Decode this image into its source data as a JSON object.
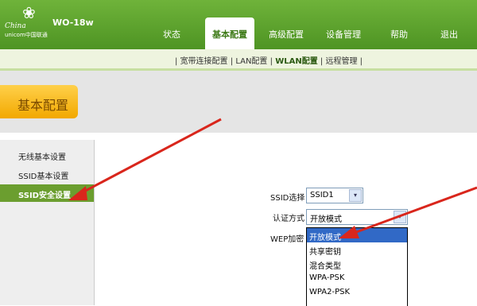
{
  "header": {
    "logo_line1": "China",
    "logo_line2": "unicom中国联通",
    "model": "WO-18w",
    "nav": [
      {
        "label": "状态",
        "active": false
      },
      {
        "label": "基本配置",
        "active": true
      },
      {
        "label": "高级配置",
        "active": false
      },
      {
        "label": "设备管理",
        "active": false
      },
      {
        "label": "帮助",
        "active": false
      },
      {
        "label": "退出",
        "active": false
      }
    ]
  },
  "subnav": {
    "sep": "|",
    "items": [
      {
        "label": "宽带连接配置",
        "active": false
      },
      {
        "label": "LAN配置",
        "active": false
      },
      {
        "label": "WLAN配置",
        "active": true
      },
      {
        "label": "远程管理",
        "active": false
      }
    ]
  },
  "section_title": "基本配置",
  "sidebar": {
    "items": [
      {
        "label": "无线基本设置",
        "active": false
      },
      {
        "label": "SSID基本设置",
        "active": false
      },
      {
        "label": "SSID安全设置",
        "active": true
      }
    ]
  },
  "form": {
    "ssid_label": "SSID选择",
    "ssid_value": "SSID1",
    "auth_label": "认证方式",
    "auth_value": "开放模式",
    "wep_label": "WEP加密",
    "arrow_glyph": "▾"
  },
  "dropdown": {
    "options": [
      "开放模式",
      "共享密钥",
      "混合类型",
      "WPA-PSK",
      "WPA2-PSK"
    ],
    "selected_index": 0
  },
  "colors": {
    "header_green": "#4e9423",
    "sidebar_active": "#6b9e2f",
    "tab_orange": "#f2a800",
    "selection_blue": "#3169c6",
    "annotation_red": "#d9261c"
  }
}
